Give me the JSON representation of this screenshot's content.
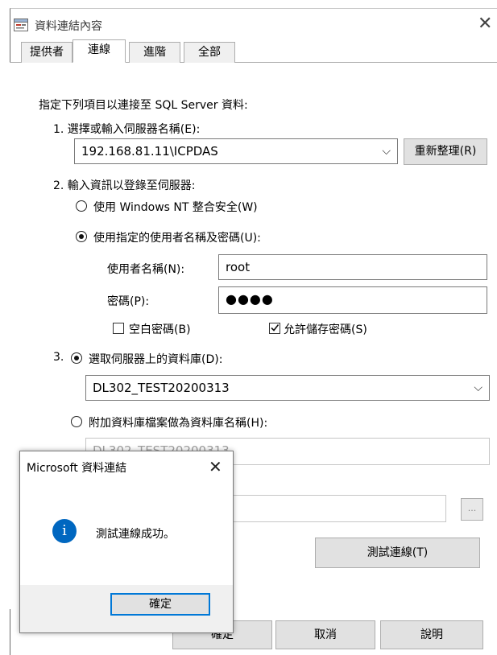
{
  "window": {
    "title": "資料連結內容",
    "close": "✕"
  },
  "tabs": [
    {
      "label": "提供者",
      "active": false
    },
    {
      "label": "連線",
      "active": true
    },
    {
      "label": "進階",
      "active": false
    },
    {
      "label": "全部",
      "active": false
    }
  ],
  "connection": {
    "intro": "指定下列項目以連接至 SQL Server 資料:",
    "step1_label": "1. 選擇或輸入伺服器名稱(E):",
    "server_value": "192.168.81.11\\ICPDAS",
    "refresh_button": "重新整理(R)",
    "step2_label": "2. 輸入資訊以登錄至伺服器:",
    "radio_windows_nt": "使用 Windows NT 整合安全(W)",
    "radio_specific_user": "使用指定的使用者名稱及密碼(U):",
    "username_label": "使用者名稱(N):",
    "username_value": "root",
    "password_label": "密碼(P):",
    "password_value": "●●●●",
    "blank_password_label": "空白密碼(B)",
    "blank_password_checked": false,
    "allow_save_password_label": "允許儲存密碼(S)",
    "allow_save_password_checked": true,
    "step3_prefix": "3.",
    "radio_select_db": "選取伺服器上的資料庫(D):",
    "database_value": "DL302_TEST20200313",
    "radio_attach_db": "附加資料庫檔案做為資料庫名稱(H):",
    "attach_db_value": "DL302_TEST20200313",
    "browse_button": "...",
    "test_connection_button": "測試連線(T)"
  },
  "footer": {
    "ok": "確定",
    "cancel": "取消",
    "help": "說明"
  },
  "message_box": {
    "title": "Microsoft 資料連結",
    "close": "✕",
    "icon": "info-icon",
    "message": "測試連線成功。",
    "ok": "確定"
  },
  "colors": {
    "info_blue": "#0067c0",
    "focus_border": "#0078d7"
  }
}
